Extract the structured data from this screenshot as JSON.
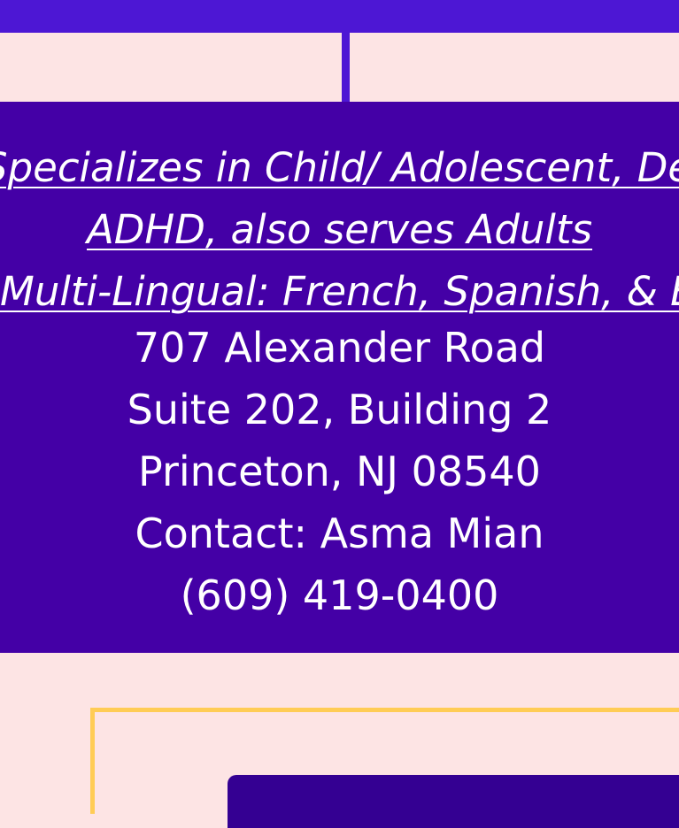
{
  "card": {
    "lines": [
      "Specializes in Child/ Adolescent, Depression, ADHD, also serves Adults",
      "Multi-Lingual: French, Spanish, & English"
    ],
    "line_a": "Specializes in Child/ Adolescent, Depression,",
    "line_b": "ADHD, also serves Adults",
    "line_c": "Multi-Lingual: French, Spanish, & English",
    "address1": "707 Alexander Road",
    "address2": "Suite 202, Building 2",
    "city": "Princeton, NJ 08540",
    "contact": "Contact: Asma Mian",
    "phone": "(609) 419-0400"
  },
  "colors": {
    "background": "#fde4e4",
    "card": "#4400a6",
    "bar": "#4d17d4",
    "frame": "#ffcc55",
    "text": "#ffffff"
  }
}
